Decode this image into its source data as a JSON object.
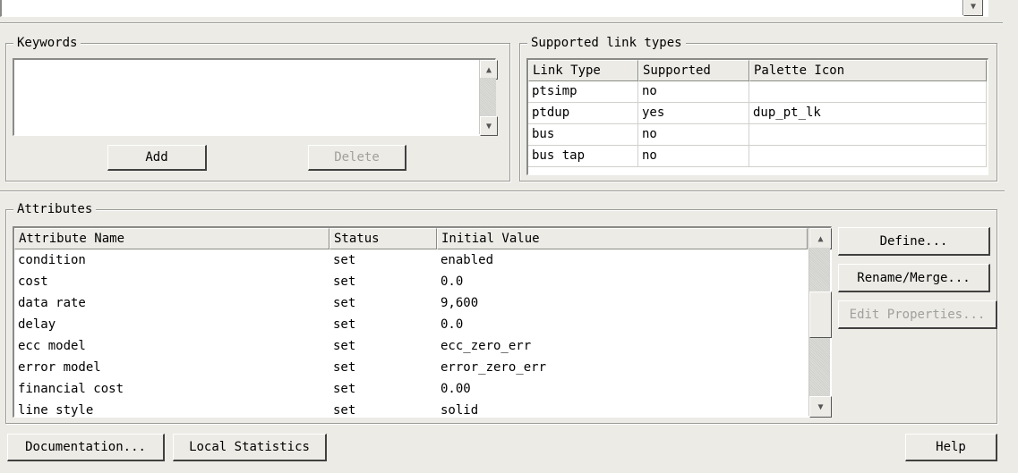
{
  "keywords": {
    "legend": "Keywords",
    "add_label": "Add",
    "delete_label": "Delete"
  },
  "link_types": {
    "legend": "Supported link types",
    "columns": [
      "Link Type",
      "Supported",
      "Palette Icon"
    ],
    "rows": [
      [
        "ptsimp",
        "no",
        ""
      ],
      [
        "ptdup",
        "yes",
        "dup_pt_lk"
      ],
      [
        "bus",
        "no",
        ""
      ],
      [
        "bus tap",
        "no",
        ""
      ]
    ]
  },
  "attributes": {
    "legend": "Attributes",
    "columns": [
      "Attribute Name",
      "Status",
      "Initial Value"
    ],
    "rows": [
      [
        "condition",
        "set",
        "enabled"
      ],
      [
        "cost",
        "set",
        "0.0"
      ],
      [
        "data rate",
        "set",
        "9,600"
      ],
      [
        "delay",
        "set",
        "0.0"
      ],
      [
        "ecc model",
        "set",
        "ecc_zero_err"
      ],
      [
        "error model",
        "set",
        "error_zero_err"
      ],
      [
        "financial cost",
        "set",
        "0.00"
      ],
      [
        "line style",
        "set",
        "solid"
      ]
    ],
    "define_label": "Define...",
    "rename_label": "Rename/Merge...",
    "edit_props_label": "Edit Properties..."
  },
  "bottom": {
    "documentation_label": "Documentation...",
    "local_stats_label": "Local Statistics",
    "help_label": "Help"
  },
  "icons": {
    "up": "▲",
    "down": "▼"
  }
}
